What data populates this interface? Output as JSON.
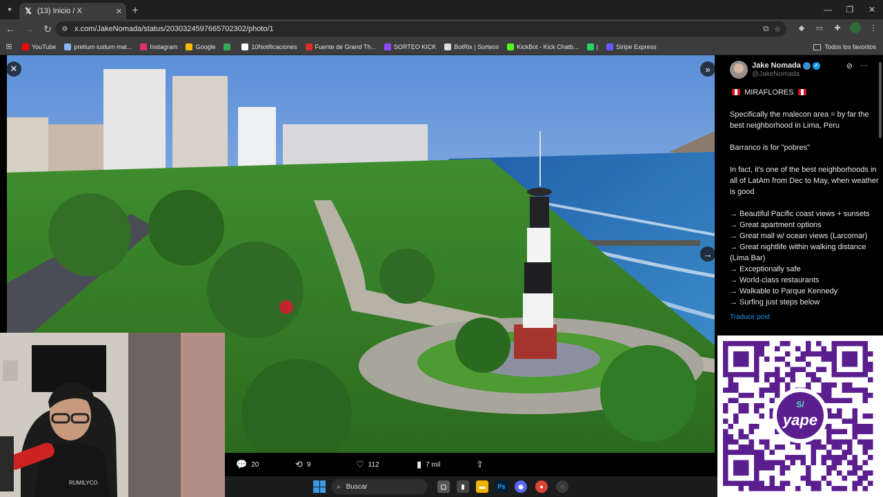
{
  "browser": {
    "tab_title": "(13) Inicio / X",
    "url": "x.com/JakeNomada/status/2030324597665702302/photo/1",
    "bookmarks": [
      {
        "label": "YouTube",
        "color": "#ff0000"
      },
      {
        "label": "pretium iustum mat...",
        "color": "#8ab4f8"
      },
      {
        "label": "Instagram",
        "color": "#e1306c"
      },
      {
        "label": "Google",
        "color": "#fbbc05"
      },
      {
        "label": "",
        "color": "#34a853"
      },
      {
        "label": "10Notificaciones",
        "color": "#ffffff"
      },
      {
        "label": "Fuente de Grand Th...",
        "color": "#d93025"
      },
      {
        "label": "SORTEO KICK",
        "color": "#9146ff"
      },
      {
        "label": "BotRix | Sorteos",
        "color": "#dddddd"
      },
      {
        "label": "KickBot - Kick Chatb...",
        "color": "#53fc18"
      },
      {
        "label": "|",
        "color": "#25d366"
      },
      {
        "label": "Stripe Express",
        "color": "#635bff"
      }
    ],
    "all_bookmarks": "Todos los favoritos"
  },
  "viewer": {
    "stats": {
      "replies": "20",
      "reposts": "9",
      "likes": "112",
      "views": "7 mil"
    }
  },
  "tweet": {
    "name": "Jake Nomada",
    "handle": "@JakeNomada",
    "heading": "MIRAFLORES",
    "p1": "Specifically the malecon area = by far the best neighborhood in Lima, Peru",
    "p2": "Barranco is for \"pobres\"",
    "p3": "In fact, it's one of the best neighborhoods in all of LatAm from Dec to May, when weather is good",
    "bullets": [
      "→ Beautiful Pacific coast views + sunsets",
      "→ Great apartment options",
      "→ Great mall w/ ocean views (Larcomar)",
      "→ Great nightlife within walking distance (Lima Bar)",
      "→ Exceptionally safe",
      "→ World-class restaurants",
      "→ Walkable to Parque Kennedy",
      "→ Surfing just steps below"
    ],
    "translate": "Traducir post"
  },
  "overlay": {
    "shirt_text": "RUMILYCO",
    "qr_logo": "yape",
    "qr_currency": "S/"
  },
  "taskbar": {
    "search": "Buscar"
  },
  "colors": {
    "accent": "#1d9bf0",
    "qr_purple": "#5b1e8f"
  }
}
